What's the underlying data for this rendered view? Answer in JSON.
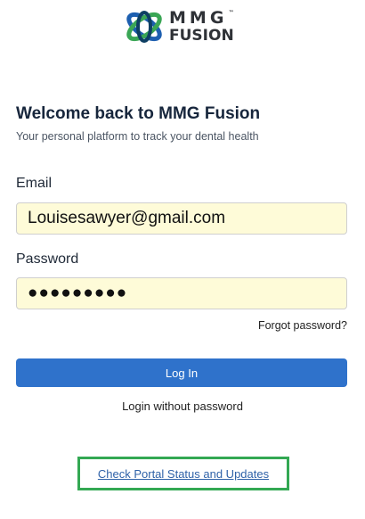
{
  "brand": {
    "logo_line1": "MMG",
    "logo_tm": "™",
    "logo_line2": "FUSION",
    "colors": {
      "ring_blue": "#1d5fb0",
      "ring_green": "#3aa655",
      "ring_dark": "#0e3f63",
      "text": "#2f3237"
    }
  },
  "welcome": {
    "title": "Welcome back to MMG Fusion",
    "subtitle": "Your personal platform to track your dental health"
  },
  "form": {
    "email_label": "Email",
    "email_value": "Louisesawyer@gmail.com",
    "password_label": "Password",
    "password_value": "●●●●●●●●●",
    "forgot_label": "Forgot password?",
    "login_label": "Log In",
    "nopass_label": "Login without password"
  },
  "footer": {
    "status_link": "Check Portal Status and Updates",
    "highlight_color": "#33a853"
  },
  "theme": {
    "primary": "#2f72cb",
    "field_bg": "#fefbd8"
  }
}
